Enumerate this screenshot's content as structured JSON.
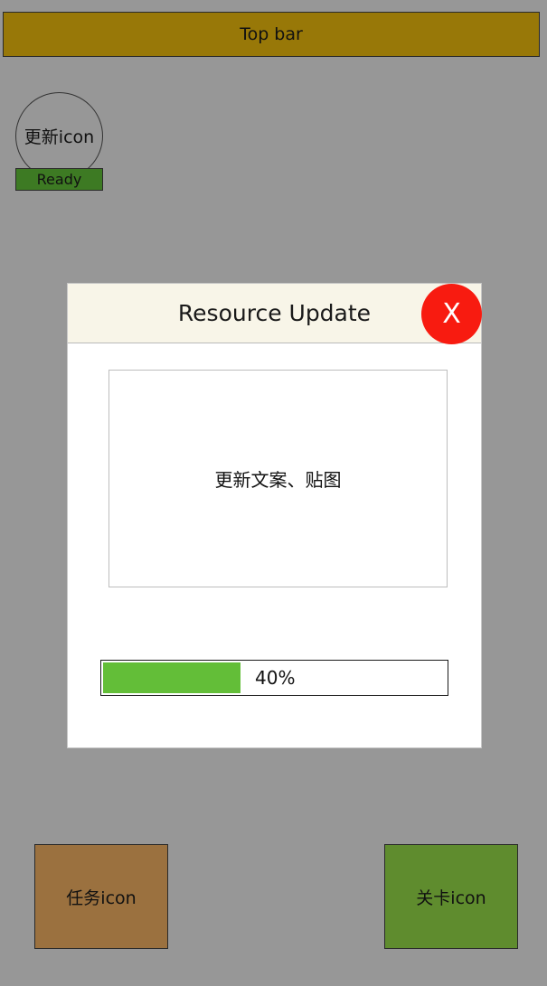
{
  "top_bar": {
    "label": "Top bar"
  },
  "update_icon": {
    "label": "更新icon",
    "status": "Ready"
  },
  "modal": {
    "title": "Resource Update",
    "close_label": "X",
    "content_text": "更新文案、贴图",
    "progress": {
      "value": 0.4,
      "label": "40%"
    }
  },
  "bottom": {
    "task_label": "任务icon",
    "level_label": "关卡icon"
  },
  "colors": {
    "background": "#979797",
    "top_bar": "#987808",
    "ready_badge": "#3d7a23",
    "modal_header": "#f8f5e8",
    "close_button": "#f81b10",
    "progress_fill": "#63be38",
    "task_icon": "#9b713f",
    "level_icon": "#5f8c2e"
  }
}
